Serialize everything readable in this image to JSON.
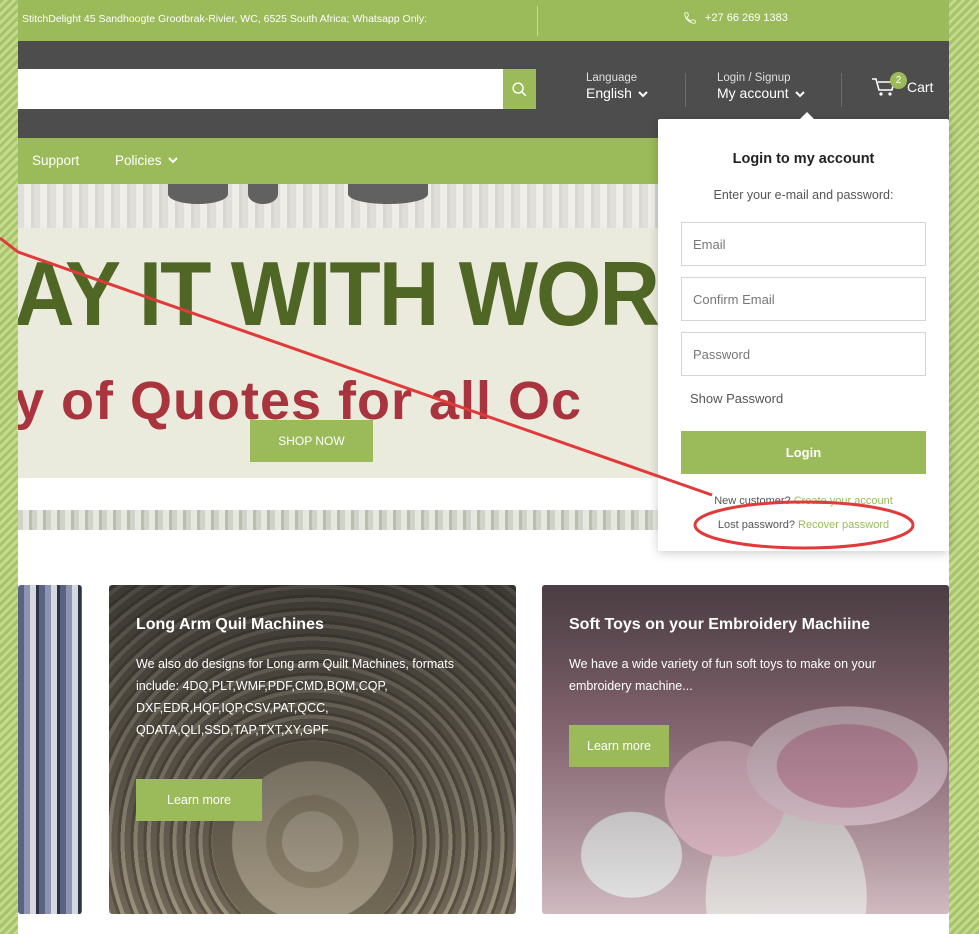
{
  "topbar": {
    "address": "StitchDelight 45 Sandhoogte Grootbrak-Rivier, WC, 6525 South Africa; Whatsapp Only:",
    "phone": "+27 66 269 1383"
  },
  "header": {
    "search_placeholder": "",
    "language_label": "Language",
    "language_value": "English",
    "login_label": "Login / Signup",
    "account_label": "My account",
    "cart_count": "2",
    "cart_label": "Cart"
  },
  "nav": {
    "support": "Support",
    "policies": "Policies"
  },
  "hero": {
    "title": "AY IT WITH WORDS",
    "subtitle": "y of Quotes for all Oc",
    "button": "SHOP NOW"
  },
  "cards": [
    {
      "title": "Long Arm Quil Machines",
      "body": "We also do designs for Long arm Quilt Machines, formats include: 4DQ,PLT,WMF,PDF,CMD,BQM,CQP, DXF,EDR,HQF,IQP,CSV,PAT,QCC, QDATA,QLI,SSD,TAP,TXT,XY,GPF",
      "button": "Learn more"
    },
    {
      "title": "Soft Toys on your Embroidery Machiine",
      "body": "We have a wide variety of fun soft toys to make on your embroidery machine...",
      "button": "Learn more"
    }
  ],
  "login_dropdown": {
    "title": "Login to my account",
    "subtitle": "Enter your e-mail and password:",
    "email_placeholder": "Email",
    "confirm_email_placeholder": "Confirm Email",
    "password_placeholder": "Password",
    "show_password": "Show Password",
    "login_button": "Login",
    "new_customer_text": "New customer?",
    "create_account_link": "Create your account",
    "lost_password_text": "Lost password?",
    "recover_password_link": "Recover password"
  },
  "colors": {
    "accent_green": "#9bba59",
    "header_dark": "#4d4d4d",
    "annotation_red": "#e03a3a"
  },
  "icons": {
    "search": "search-icon",
    "phone": "phone-icon",
    "cart": "cart-icon",
    "chevron": "chevron-down-icon"
  }
}
